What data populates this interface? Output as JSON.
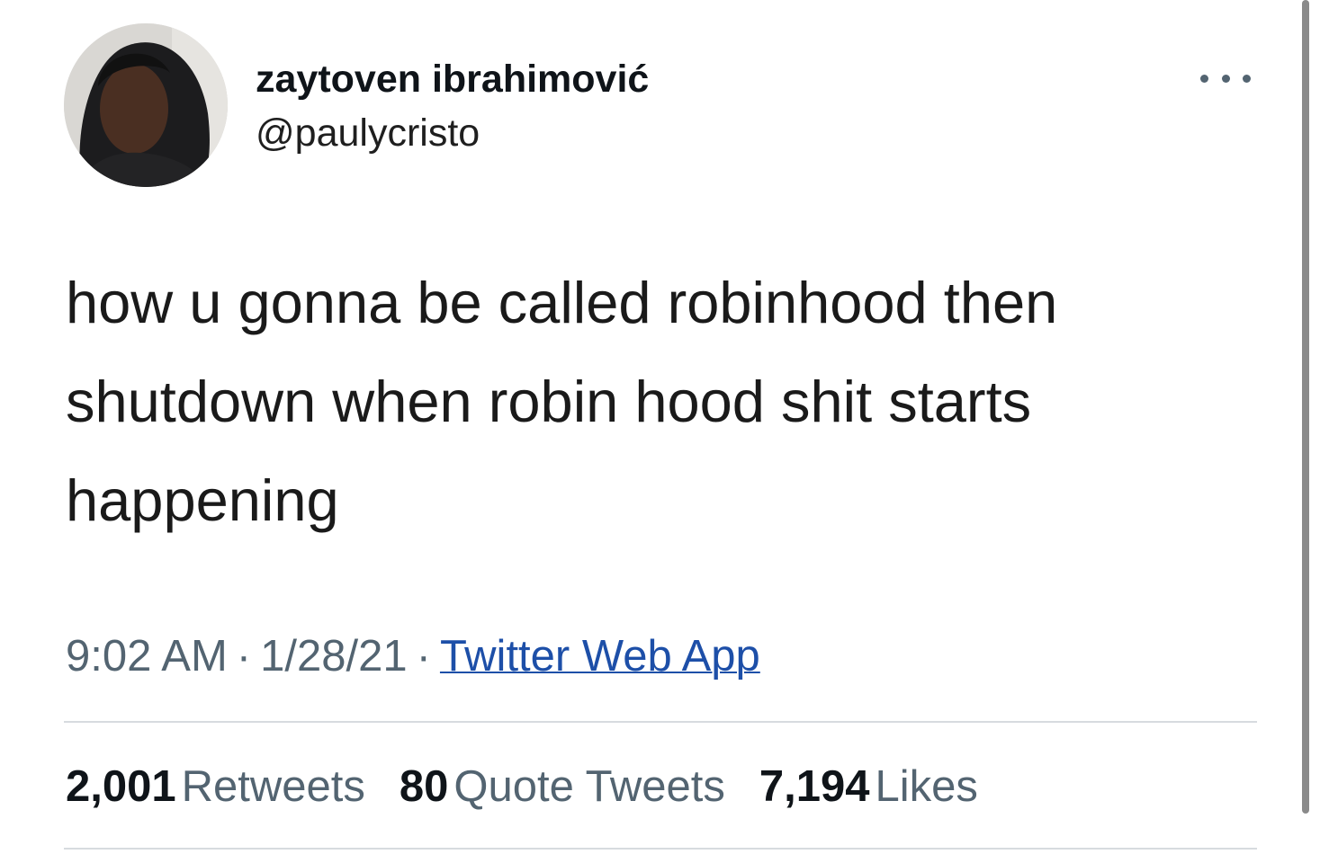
{
  "author": {
    "display_name": "zaytoven ibrahimović",
    "handle": "@paulycristo"
  },
  "tweet": {
    "text": "how u gonna be called robinhood then shutdown when robin hood shit starts happening",
    "time": "9:02 AM",
    "date": "1/28/21",
    "separator": "·",
    "source": "Twitter Web App"
  },
  "stats": {
    "retweets_count": "2,001",
    "retweets_label": "Retweets",
    "quotes_count": "80",
    "quotes_label": "Quote Tweets",
    "likes_count": "7,194",
    "likes_label": "Likes"
  },
  "icons": {
    "more": "more-horizontal-icon"
  },
  "colors": {
    "link": "#1d4fa8",
    "secondary_text": "#536471",
    "primary_text": "#0f1419",
    "divider": "#d7dbdf"
  }
}
